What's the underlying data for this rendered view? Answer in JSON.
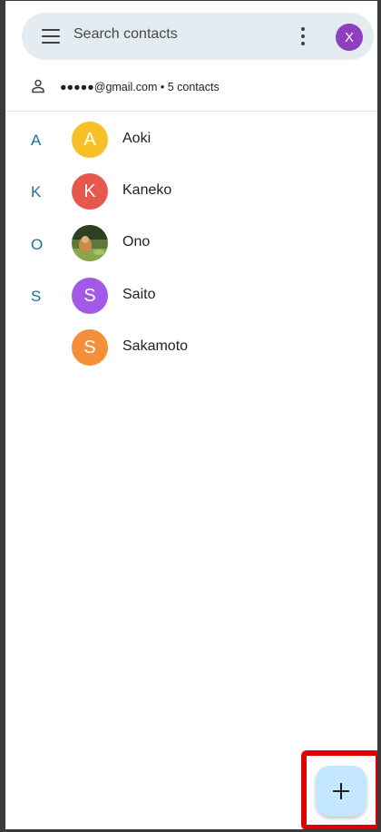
{
  "search": {
    "placeholder": "Search contacts",
    "menu_icon": "hamburger-menu-icon",
    "more_icon": "more-vert-icon",
    "account_initial": "X",
    "account_color": "#8e3fbf"
  },
  "account": {
    "icon": "person-outline-icon",
    "text": "●●●●●@gmail.com • 5 contacts"
  },
  "index_letters": [
    "A",
    "K",
    "O",
    "S"
  ],
  "contacts": [
    {
      "name": "Aoki",
      "initial": "A",
      "color": "#f6c026"
    },
    {
      "name": "Kaneko",
      "initial": "K",
      "color": "#e8574e"
    },
    {
      "name": "Ono",
      "initial": "",
      "color": "photo"
    },
    {
      "name": "Saito",
      "initial": "S",
      "color": "#a259e6"
    },
    {
      "name": "Sakamoto",
      "initial": "S",
      "color": "#f68f3a"
    }
  ],
  "fab": {
    "icon": "plus-icon",
    "color": "#c2e7ff",
    "highlight_color": "#e00000"
  }
}
